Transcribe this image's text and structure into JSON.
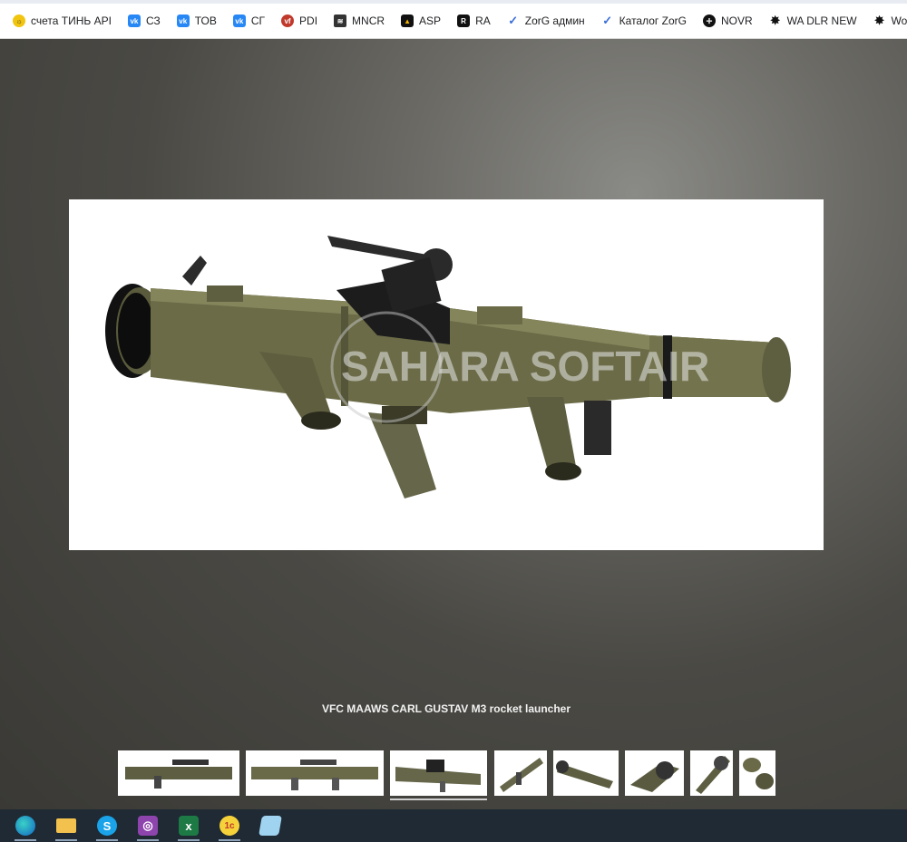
{
  "bookmarks": [
    {
      "label": "счета ТИНЬ API",
      "icon": "tin-icon"
    },
    {
      "label": "СЗ",
      "icon": "vk-icon"
    },
    {
      "label": "ТОВ",
      "icon": "vk-icon"
    },
    {
      "label": "СГ",
      "icon": "vk-icon"
    },
    {
      "label": "PDI",
      "icon": "vfc-icon"
    },
    {
      "label": "MNCR",
      "icon": "mncr-icon"
    },
    {
      "label": "ASP",
      "icon": "asp-icon"
    },
    {
      "label": "RA",
      "icon": "ra-icon"
    },
    {
      "label": "ZorG админ",
      "icon": "zorg-icon"
    },
    {
      "label": "Каталог ZorG",
      "icon": "zorg-icon"
    },
    {
      "label": "NOVR",
      "icon": "novr-icon"
    },
    {
      "label": "WA DLR NEW",
      "icon": "wa-icon"
    },
    {
      "label": "Wolverine Air",
      "icon": "wa-icon"
    }
  ],
  "viewer": {
    "caption": "VFC MAAWS CARL GUSTAV M3 rocket launcher",
    "watermark": "SAHARA SOFTAIR",
    "thumbnails_count": 8,
    "active_thumbnail": 3
  },
  "taskbar": {
    "apps": [
      "edge-icon",
      "file-explorer-icon",
      "skype-icon",
      "photos-icon",
      "excel-icon",
      "1c-icon",
      "notepad-icon"
    ]
  },
  "colors": {
    "launcher": "#6b6b48",
    "taskbar": "#1f2a35",
    "vk": "#2787f5"
  }
}
